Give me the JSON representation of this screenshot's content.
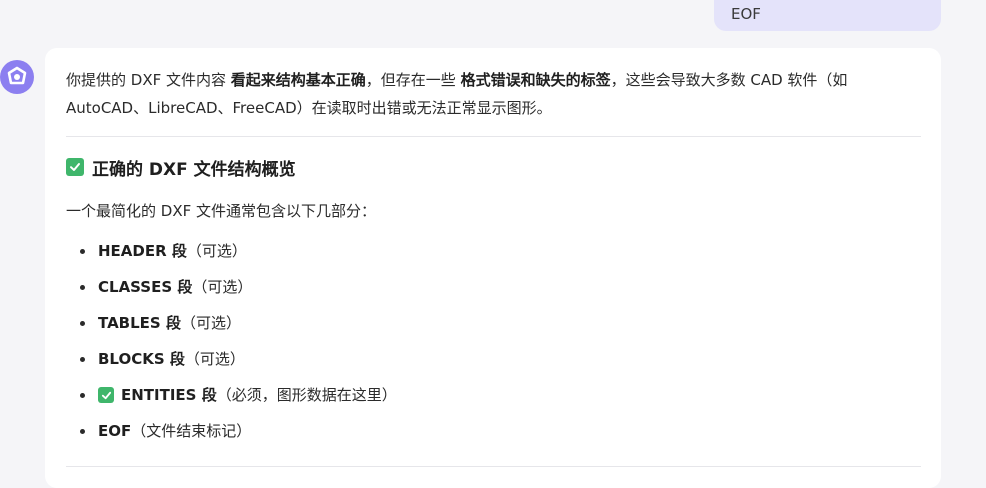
{
  "user_message": {
    "text": "EOF"
  },
  "assistant": {
    "intro": {
      "p1": "你提供的 DXF 文件内容 ",
      "b1": "看起来结构基本正确",
      "p2": "，但存在一些 ",
      "b2": "格式错误和缺失的标签",
      "p3": "，这些会导致大多数 CAD 软件（如 AutoCAD、LibreCAD、FreeCAD）在读取时出错或无法正常显示图形。"
    },
    "heading": "正确的 DXF 文件结构概览",
    "subtext": "一个最简化的 DXF 文件通常包含以下几部分：",
    "sections": [
      {
        "name": "HEADER 段",
        "note": "（可选）",
        "check": false
      },
      {
        "name": "CLASSES 段",
        "note": "（可选）",
        "check": false
      },
      {
        "name": "TABLES 段",
        "note": "（可选）",
        "check": false
      },
      {
        "name": "BLOCKS 段",
        "note": "（可选）",
        "check": false
      },
      {
        "name": "ENTITIES 段",
        "note": "（必须，图形数据在这里）",
        "check": true
      },
      {
        "name": "EOF",
        "note": "（文件结束标记）",
        "check": false
      }
    ]
  },
  "colors": {
    "accent": "#8c7ff0",
    "check_green": "#3fb66b",
    "user_bubble": "#e4e3fa"
  },
  "icons": {
    "avatar": "assistant-logo-icon",
    "check": "check-mark-icon"
  }
}
